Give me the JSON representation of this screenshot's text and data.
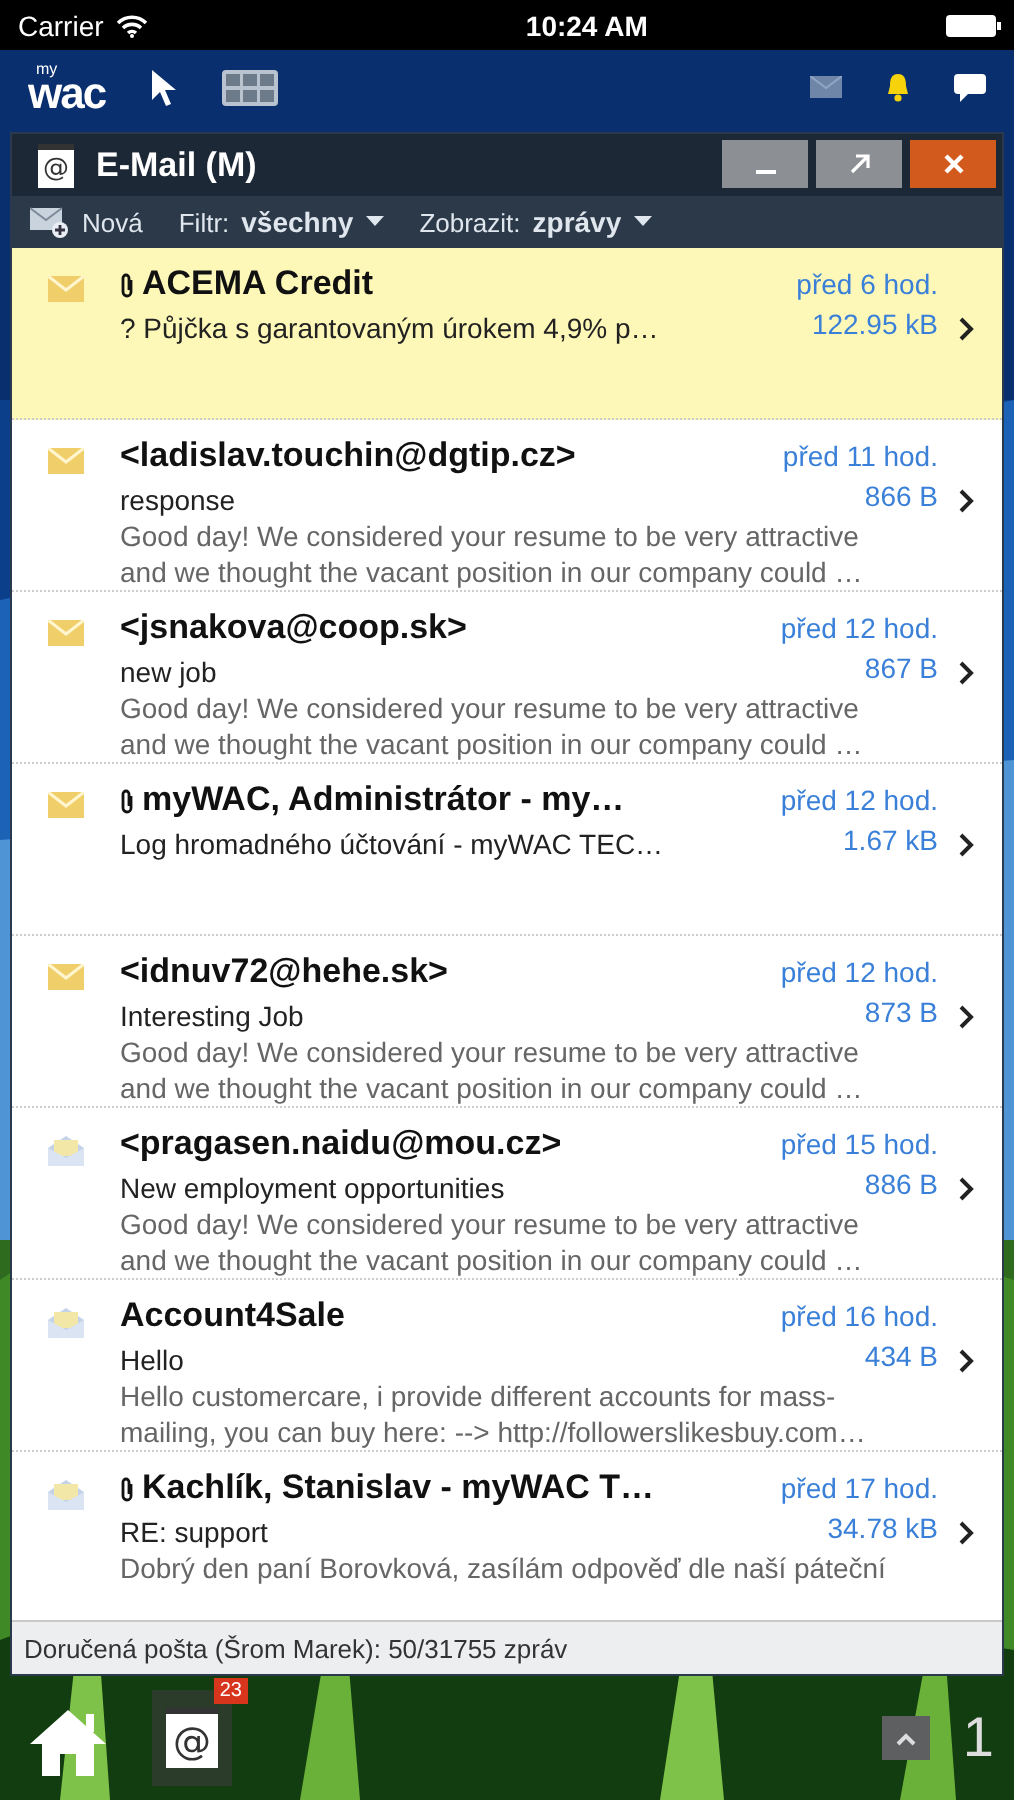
{
  "status_bar": {
    "carrier": "Carrier",
    "time": "10:24 AM"
  },
  "app_bar": {
    "logo_small": "my",
    "logo_main": "wac"
  },
  "window": {
    "icon": "@",
    "title": "E-Mail (M)",
    "buttons": [
      {
        "kind": "minimize"
      },
      {
        "kind": "maximize"
      },
      {
        "kind": "close"
      }
    ]
  },
  "toolbar": {
    "new_label": "Nová",
    "filter_label": "Filtr:",
    "filter_value": "všechny",
    "view_label": "Zobrazit:",
    "view_value": "zprávy"
  },
  "messages": [
    {
      "sender": "ACEMA Credit",
      "subject": "? Půjčka s garantovaným úrokem 4,9% p…",
      "time": "před 6 hod.",
      "size": "122.95 kB",
      "read": false,
      "attachment": true,
      "selected": true
    },
    {
      "sender": "<ladislav.touchin@dgtip.cz>",
      "subject": "response",
      "preview_lines": [
        "Good day! We considered your resume to be very attractive",
        "and we thought the vacant position in our company could …"
      ],
      "time": "před 11 hod.",
      "size": "866 B",
      "read": false,
      "attachment": false,
      "selected": false
    },
    {
      "sender": "<jsnakova@coop.sk>",
      "subject": "new job",
      "preview_lines": [
        "Good day! We considered your resume to be very attractive",
        "and we thought the vacant position in our company could …"
      ],
      "time": "před 12 hod.",
      "size": "867 B",
      "read": false,
      "attachment": false,
      "selected": false
    },
    {
      "sender": "myWAC, Administrátor - my…",
      "subject": "Log hromadného účtování - myWAC TEC…",
      "time": "před 12 hod.",
      "size": "1.67 kB",
      "read": false,
      "attachment": true,
      "selected": false
    },
    {
      "sender": "<idnuv72@hehe.sk>",
      "subject": "Interesting Job",
      "preview_lines": [
        "Good day! We considered your resume to be very attractive",
        "and we thought the vacant position in our company could …"
      ],
      "time": "před 12 hod.",
      "size": "873 B",
      "read": false,
      "attachment": false,
      "selected": false
    },
    {
      "sender": "<pragasen.naidu@mou.cz>",
      "subject": "New employment opportunities",
      "preview_lines": [
        "Good day! We considered your resume to be very attractive",
        "and we thought the vacant position in our company could …"
      ],
      "time": "před 15 hod.",
      "size": "886 B",
      "read": true,
      "attachment": false,
      "selected": false
    },
    {
      "sender": "Account4Sale",
      "subject": "Hello",
      "preview_lines": [
        "Hello customercare, i provide different accounts for mass-",
        "mailing, you can buy here: --> http://followerslikesbuy.com…"
      ],
      "time": "před 16 hod.",
      "size": "434 B",
      "read": true,
      "attachment": false,
      "selected": false
    },
    {
      "sender": "Kachlík, Stanislav - myWAC T…",
      "subject": "RE: support",
      "preview_lines": [
        "Dobrý den paní Borovková,  zasílám odpověď dle naší páteční"
      ],
      "time": "před 17 hod.",
      "size": "34.78 kB",
      "read": true,
      "attachment": true,
      "selected": false
    }
  ],
  "footer": "Doručená pošta (Šrom Marek): 50/31755 zpráv",
  "taskbar": {
    "app_icon": "@",
    "badge": "23",
    "page": "1"
  }
}
